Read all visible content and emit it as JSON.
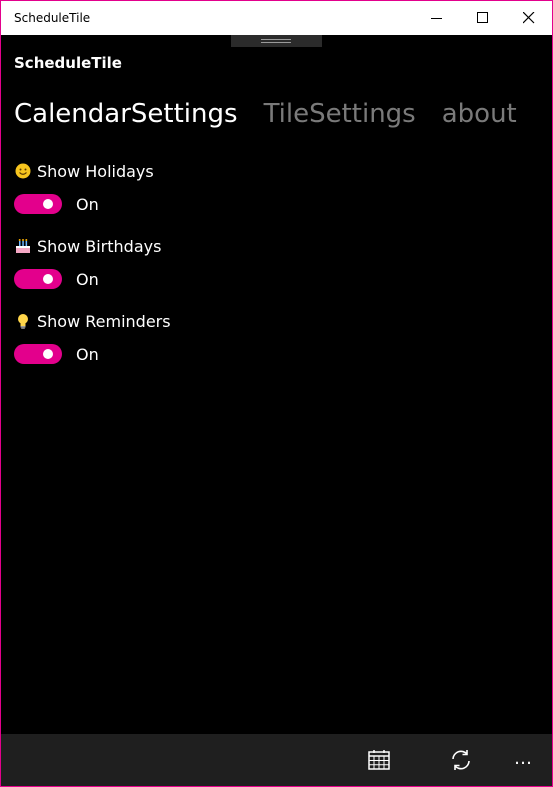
{
  "window": {
    "title": "ScheduleTile"
  },
  "app": {
    "name": "ScheduleTile"
  },
  "pivot": {
    "items": [
      {
        "label": "CalendarSettings",
        "active": true
      },
      {
        "label": "TileSettings",
        "active": false
      },
      {
        "label": "about",
        "active": false
      }
    ]
  },
  "settings": [
    {
      "label": "Show Holidays",
      "icon": "smiley-icon",
      "state": "On"
    },
    {
      "label": "Show Birthdays",
      "icon": "cake-icon",
      "state": "On"
    },
    {
      "label": "Show Reminders",
      "icon": "lightbulb-icon",
      "state": "On"
    }
  ],
  "appbar": {
    "buttons": [
      "calendar-icon",
      "refresh-icon"
    ],
    "more": "…"
  },
  "colors": {
    "accent": "#e3008c",
    "background": "#000000",
    "appbar": "#1f1f1f"
  }
}
